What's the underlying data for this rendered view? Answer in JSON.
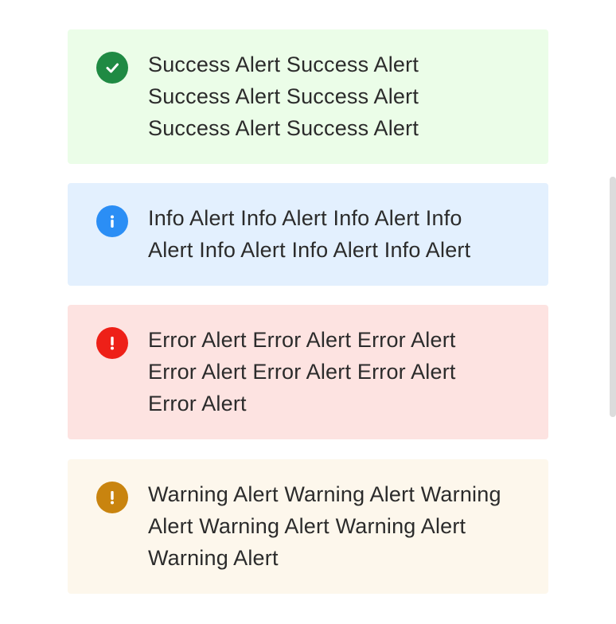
{
  "alerts": {
    "success": {
      "text": "Success Alert Success Alert Success Alert Success Alert Success Alert Success Alert",
      "icon": "check-circle-icon",
      "background": "#ebfde8",
      "icon_color": "#1f8a43"
    },
    "info": {
      "text": "Info Alert Info Alert Info Alert Info Alert Info Alert Info Alert Info Alert",
      "icon": "info-circle-icon",
      "background": "#e3f0fe",
      "icon_color": "#2b8ef5"
    },
    "error": {
      "text": "Error Alert Error Alert Error Alert Error Alert Error Alert Error Alert Error Alert",
      "icon": "exclamation-circle-icon",
      "background": "#fde3e1",
      "icon_color": "#ee2018"
    },
    "warning": {
      "text": "Warning Alert Warning Alert Warning Alert Warning Alert Warning Alert Warning Alert",
      "icon": "exclamation-circle-icon",
      "background": "#fdf7ec",
      "icon_color": "#c9840f"
    }
  }
}
